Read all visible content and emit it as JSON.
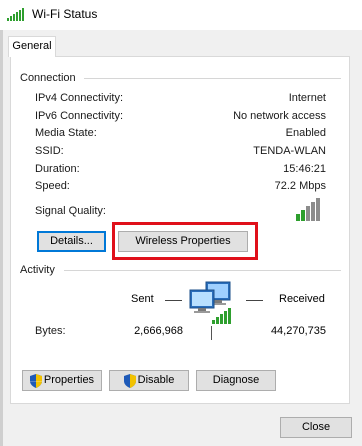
{
  "window": {
    "title": "Wi-Fi Status",
    "icon": "wifi-bars-icon"
  },
  "tabs": [
    {
      "label": "General"
    }
  ],
  "connection": {
    "header": "Connection",
    "rows": [
      {
        "label": "IPv4 Connectivity:",
        "value": "Internet"
      },
      {
        "label": "IPv6 Connectivity:",
        "value": "No network access"
      },
      {
        "label": "Media State:",
        "value": "Enabled"
      },
      {
        "label": "SSID:",
        "value": "TENDA-WLAN"
      },
      {
        "label": "Duration:",
        "value": "15:46:21"
      },
      {
        "label": "Speed:",
        "value": "72.2 Mbps"
      }
    ],
    "signal_label": "Signal Quality:",
    "signal_bars": 5,
    "details_button": "Details...",
    "wireless_properties_button": "Wireless Properties"
  },
  "activity": {
    "header": "Activity",
    "sent_label": "Sent",
    "received_label": "Received",
    "bytes_label": "Bytes:",
    "bytes_sent": "2,666,968",
    "bytes_received": "44,270,735",
    "icon": "network-computers-icon"
  },
  "actions": {
    "properties": "Properties",
    "disable": "Disable",
    "diagnose": "Diagnose"
  },
  "footer": {
    "close": "Close"
  },
  "colors": {
    "accent": "#0078d7",
    "highlight": "#e0101a",
    "signal_green": "#2e9f2e",
    "dialog_bg": "#f0f0f0"
  }
}
